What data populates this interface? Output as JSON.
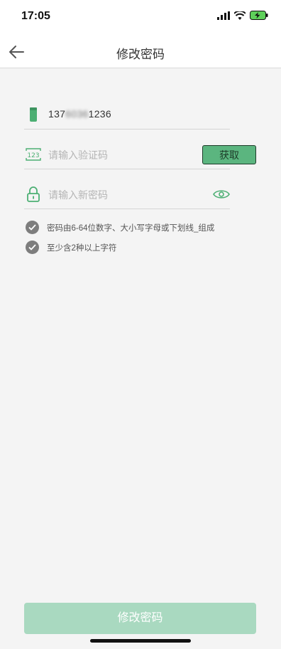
{
  "status": {
    "time": "17:05"
  },
  "nav": {
    "title": "修改密码",
    "back_icon": "arrow-left-icon"
  },
  "phone": {
    "value_prefix": "137",
    "value_masked": "6036",
    "value_suffix": "1236",
    "icon": "phone-icon"
  },
  "code": {
    "placeholder": "请输入验证码",
    "button": "获取",
    "icon": "number-123-icon"
  },
  "password": {
    "placeholder": "请输入新密码",
    "icon": "lock-icon",
    "toggle_icon": "eye-icon"
  },
  "rules": [
    {
      "text": "密码由6-64位数字、大小写字母或下划线_组成"
    },
    {
      "text": "至少含2种以上字符"
    }
  ],
  "submit": {
    "label": "修改密码"
  },
  "colors": {
    "accent": "#5bb57f",
    "submit_bg": "#a9d9c0",
    "icon_green": "#4caf73"
  }
}
